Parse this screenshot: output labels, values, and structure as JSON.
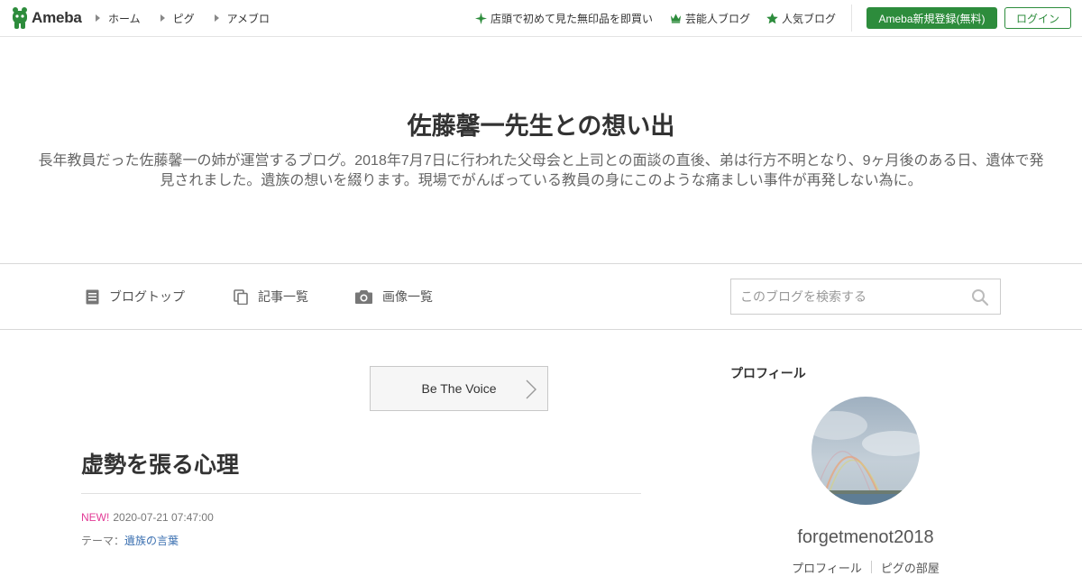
{
  "header": {
    "logo_text": "Ameba",
    "nav": [
      "ホーム",
      "ピグ",
      "アメブロ"
    ],
    "promos": [
      {
        "label": "店頭で初めて見た無印品を即買い",
        "icon": "sparkle-icon"
      },
      {
        "label": "芸能人ブログ",
        "icon": "crown-icon"
      },
      {
        "label": "人気ブログ",
        "icon": "star-icon"
      }
    ],
    "register_label": "Ameba新規登録(無料)",
    "login_label": "ログイン",
    "accent": "#2d8c3c"
  },
  "blog": {
    "title": "佐藤馨一先生との想い出",
    "description": "長年教員だった佐藤馨一の姉が運営するブログ。2018年7月7日に行われた父母会と上司との面談の直後、弟は行方不明となり、9ヶ月後のある日、遺体で発見されました。遺族の想いを綴ります。現場でがんばっている教員の身にこのような痛ましい事件が再発しない為に。"
  },
  "blog_nav": {
    "items": [
      {
        "label": "ブログトップ",
        "icon": "document-icon"
      },
      {
        "label": "記事一覧",
        "icon": "copy-icon"
      },
      {
        "label": "画像一覧",
        "icon": "camera-icon"
      }
    ],
    "search_placeholder": "このブログを検索する"
  },
  "main": {
    "banner_label": "Be The Voice",
    "entry_title": "虚勢を張る心理",
    "new_badge": "NEW!",
    "date": "2020-07-21 07:47:00",
    "theme_label": "テーマ：",
    "theme_link": "遺族の言葉"
  },
  "sidebar": {
    "heading": "プロフィール",
    "profile_name": "forgetmenot2018",
    "links": [
      "プロフィール",
      "ピグの部屋"
    ]
  }
}
